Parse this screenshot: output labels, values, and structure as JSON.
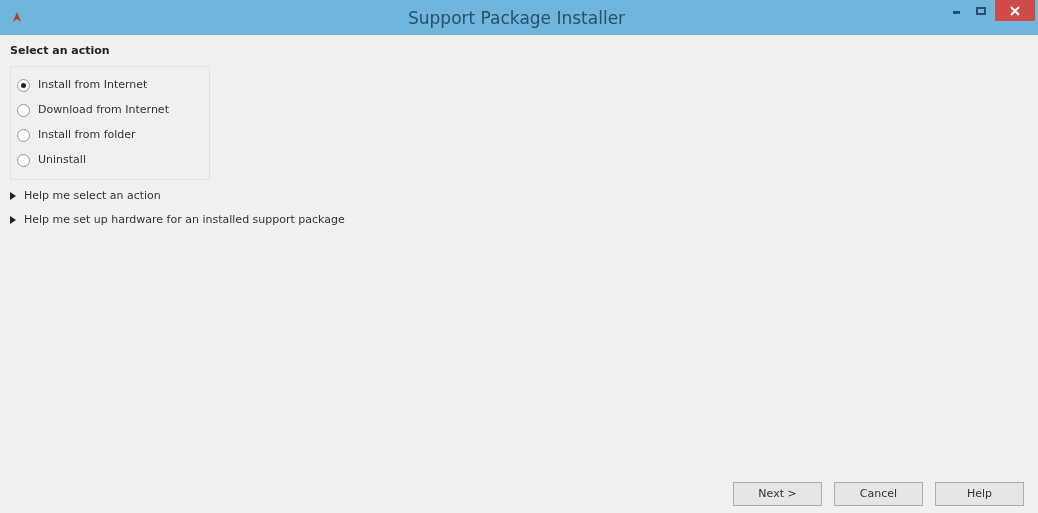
{
  "window": {
    "title": "Support Package Installer"
  },
  "heading": "Select an action",
  "actions": [
    {
      "label": "Install from Internet",
      "selected": true
    },
    {
      "label": "Download from Internet",
      "selected": false
    },
    {
      "label": "Install from folder",
      "selected": false
    },
    {
      "label": "Uninstall",
      "selected": false
    }
  ],
  "help_sections": [
    {
      "label": "Help me select an action",
      "expanded": false
    },
    {
      "label": "Help me set up hardware for an installed support package",
      "expanded": false
    }
  ],
  "buttons": [
    "Next >",
    "Cancel",
    "Help"
  ]
}
